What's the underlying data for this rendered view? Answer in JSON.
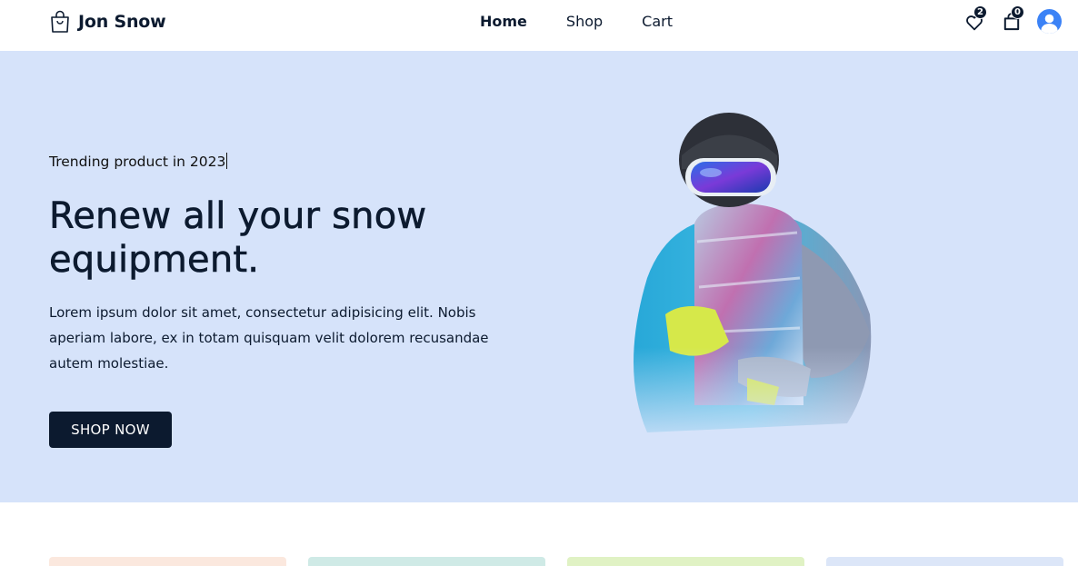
{
  "brand": {
    "name": "Jon Snow",
    "icon": "shopping-bag-icon"
  },
  "nav": {
    "items": [
      {
        "label": "Home",
        "active": true
      },
      {
        "label": "Shop",
        "active": false
      },
      {
        "label": "Cart",
        "active": false
      }
    ]
  },
  "header_icons": {
    "wishlist": {
      "icon": "heart-icon",
      "count": "2"
    },
    "cart": {
      "icon": "bag-icon",
      "count": "0"
    },
    "profile": {
      "icon": "user-avatar-icon"
    }
  },
  "hero": {
    "tagline": "Trending product in 2023",
    "headline": "Renew all your snow equipment.",
    "description": "Lorem ipsum dolor sit amet, consectetur adipisicing elit. Nobis aperiam labore, ex in totam quisquam velit dolorem recusandae autem molestiae.",
    "cta_label": "SHOP NOW",
    "image": "snowboarder-photo",
    "background": "#d6e3fa"
  },
  "category_cards": [
    {
      "color": "#fbe8de"
    },
    {
      "color": "#cfeae6"
    },
    {
      "color": "#e0f2c4"
    },
    {
      "color": "#dce6f8"
    }
  ],
  "colors": {
    "primary": "#0c1a2f",
    "accent": "#3b82f6"
  }
}
